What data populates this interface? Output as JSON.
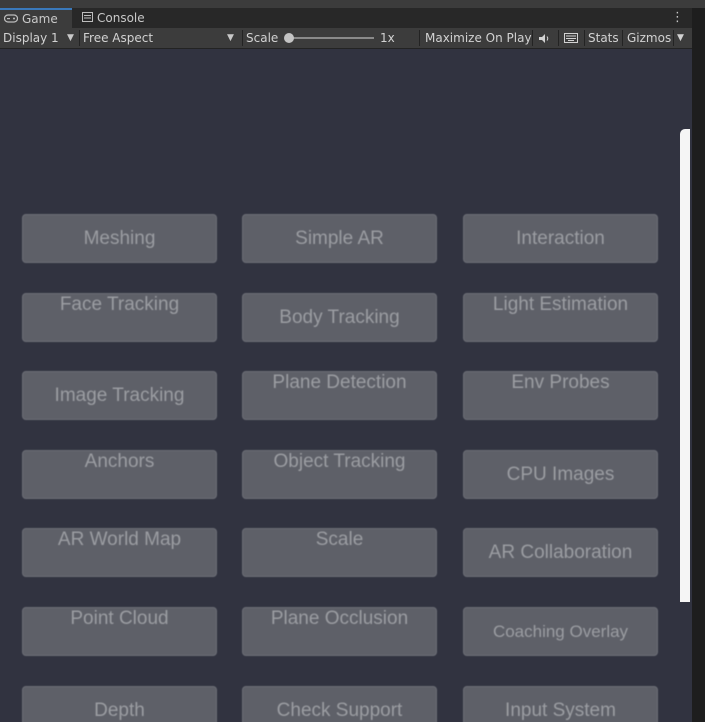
{
  "tabs": [
    {
      "label": "Game",
      "icon": "gamepad-icon"
    },
    {
      "label": "Console",
      "icon": "console-icon"
    }
  ],
  "toolbar": {
    "display": "Display 1",
    "aspect": "Free Aspect",
    "scale_label": "Scale",
    "scale_value": "1x",
    "maximize": "Maximize On Play",
    "stats": "Stats",
    "gizmos": "Gizmos"
  },
  "buttons": [
    {
      "label": "Meshing",
      "col": 0,
      "row": 0,
      "text_align": "center"
    },
    {
      "label": "Simple AR",
      "col": 1,
      "row": 0,
      "text_align": "center"
    },
    {
      "label": "Interaction",
      "col": 2,
      "row": 0,
      "text_align": "center"
    },
    {
      "label": "Face Tracking",
      "col": 0,
      "row": 1,
      "text_align": "top"
    },
    {
      "label": "Body Tracking",
      "col": 1,
      "row": 1,
      "text_align": "center"
    },
    {
      "label": "Light Estimation",
      "col": 2,
      "row": 1,
      "text_align": "top"
    },
    {
      "label": "Image Tracking",
      "col": 0,
      "row": 2,
      "text_align": "center"
    },
    {
      "label": "Plane Detection",
      "col": 1,
      "row": 2,
      "text_align": "top"
    },
    {
      "label": "Env Probes",
      "col": 2,
      "row": 2,
      "text_align": "top"
    },
    {
      "label": "Anchors",
      "col": 0,
      "row": 3,
      "text_align": "top"
    },
    {
      "label": "Object Tracking",
      "col": 1,
      "row": 3,
      "text_align": "top"
    },
    {
      "label": "CPU Images",
      "col": 2,
      "row": 3,
      "text_align": "center"
    },
    {
      "label": "AR World Map",
      "col": 0,
      "row": 4,
      "text_align": "top"
    },
    {
      "label": "Scale",
      "col": 1,
      "row": 4,
      "text_align": "top"
    },
    {
      "label": "AR Collaboration",
      "col": 2,
      "row": 4,
      "text_align": "center"
    },
    {
      "label": "Point Cloud",
      "col": 0,
      "row": 5,
      "text_align": "top"
    },
    {
      "label": "Plane Occlusion",
      "col": 1,
      "row": 5,
      "text_align": "top"
    },
    {
      "label": "Coaching Overlay",
      "col": 2,
      "row": 5,
      "text_align": "center-small"
    },
    {
      "label": "Depth",
      "col": 0,
      "row": 6,
      "text_align": "center"
    },
    {
      "label": "Check Support",
      "col": 1,
      "row": 6,
      "text_align": "center"
    },
    {
      "label": "Input System",
      "col": 2,
      "row": 6,
      "text_align": "center"
    }
  ]
}
